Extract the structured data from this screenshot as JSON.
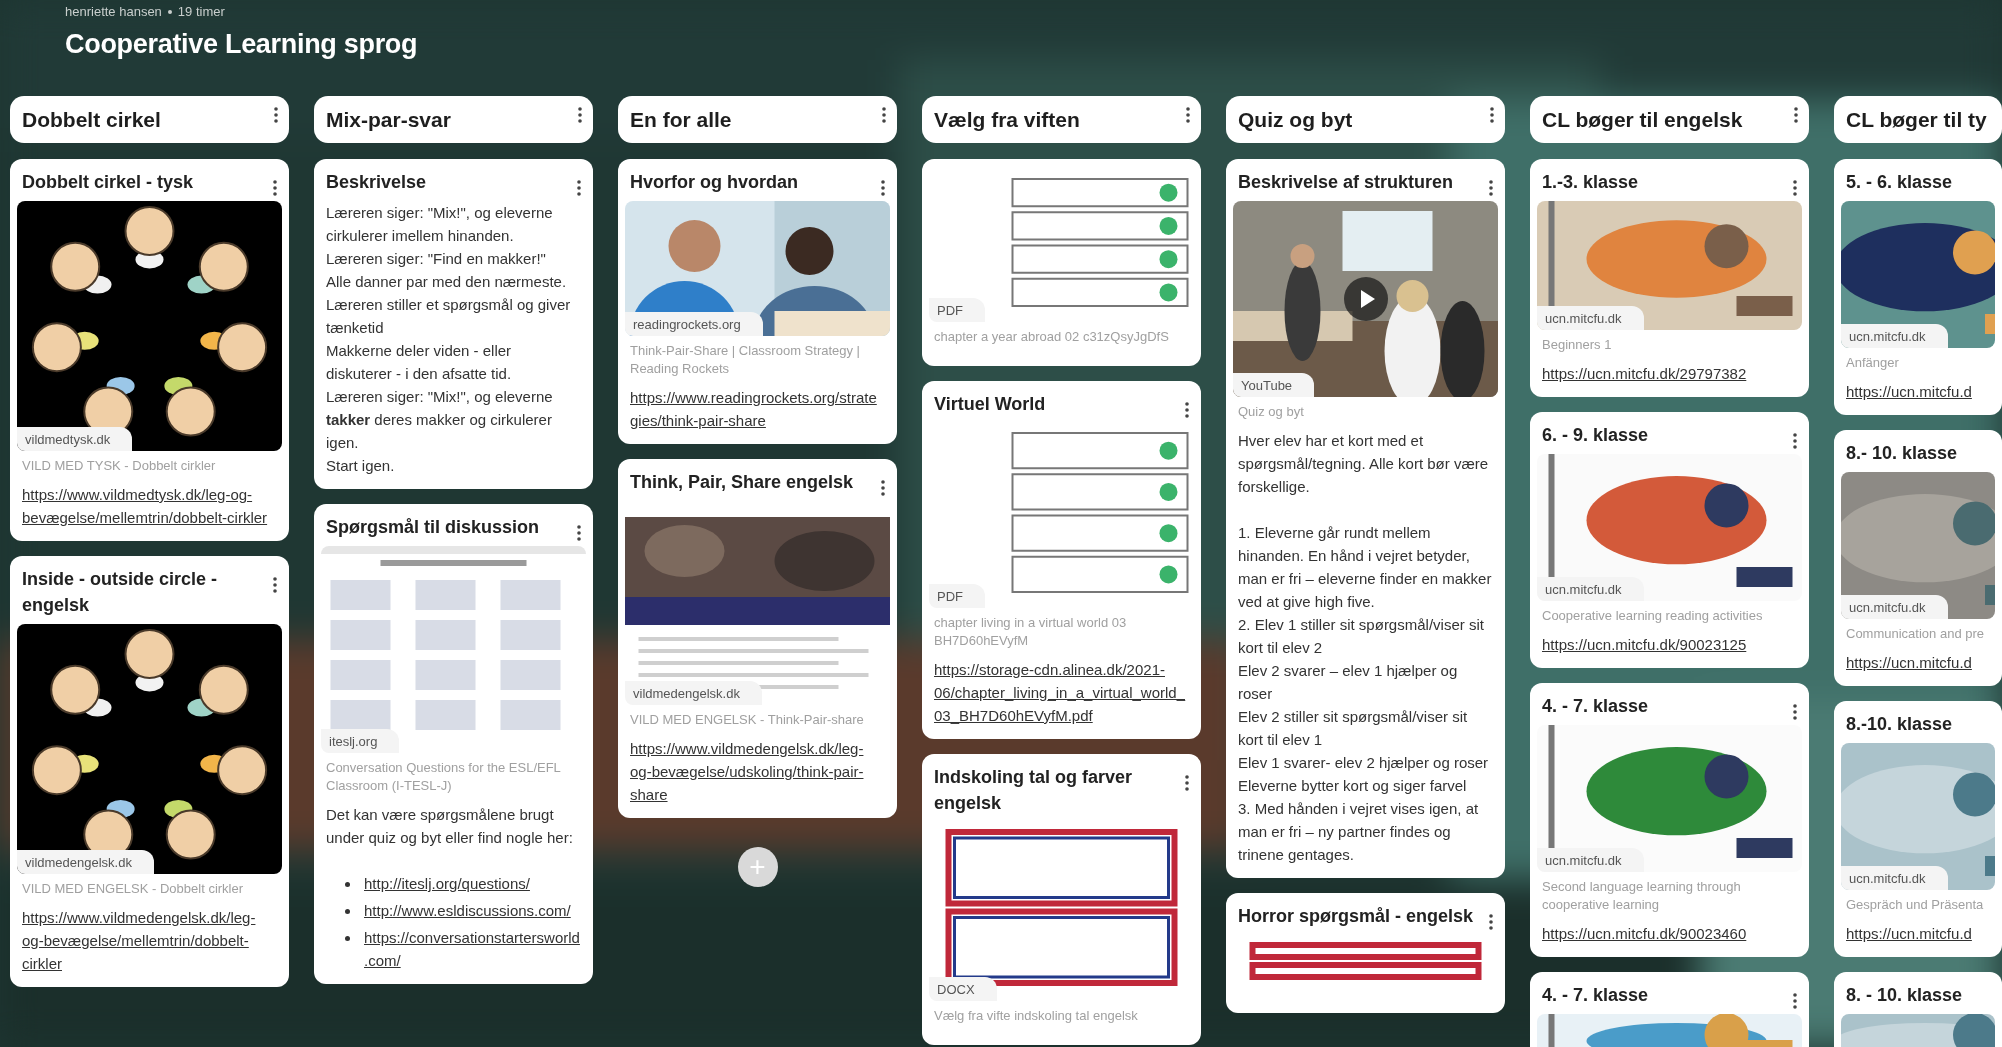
{
  "header": {
    "author": "henriette hansen",
    "time": "19 timer",
    "title": "Cooperative Learning sprog"
  },
  "columns": [
    {
      "title": "Dobbelt cirkel",
      "cut_off": false,
      "posts": [
        {
          "title": "Dobbelt cirkel - tysk",
          "attachment": {
            "kind": "picture",
            "source": "vildmedtysk.dk"
          },
          "caption": "VILD MED TYSK - Dobbelt cirkler",
          "link": "https://www.vildmedtysk.dk/leg-og-bevægelse/mellemtrin/dobbelt-cirkler"
        },
        {
          "title": "Inside - outside circle - engelsk",
          "attachment": {
            "kind": "picture",
            "source": "vildmedengelsk.dk"
          },
          "caption": "VILD MED ENGELSK - Dobbelt cirkler",
          "link": "https://www.vildmedengelsk.dk/leg-og-bevægelse/mellemtrin/dobbelt-cirkler"
        }
      ]
    },
    {
      "title": "Mix-par-svar",
      "cut_off": false,
      "posts": [
        {
          "title": "Beskrivelse",
          "body": [
            [
              "Læreren siger: \"Mix!\", og eleverne cirkulerer imellem hinanden.",
              "Læreren siger: \"Find en makker!\"",
              "Alle danner par med den nærmeste.",
              "Læreren stiller et spørgsmål og giver tænketid",
              "Makkerne deler viden - eller diskuterer - i den afsatte tid.",
              "Læreren siger: \"Mix!\", og eleverne **takker** deres makker og cirkulerer igen.",
              "Start igen."
            ]
          ]
        },
        {
          "title": "Spørgsmål til diskussion",
          "attachment": {
            "kind": "picture",
            "source": "iteslj.org"
          },
          "caption": "Conversation Questions for the ESL/EFL Classroom (I-TESL-J)",
          "body": [
            [
              "Det kan være spørgsmålene brugt under quiz og byt eller find nogle her:"
            ]
          ],
          "links": [
            "http://iteslj.org/questions/",
            "http://www.esldiscussions.com/",
            "https://conversationstartersworld.com/"
          ]
        }
      ]
    },
    {
      "title": "En for alle",
      "cut_off": false,
      "add_button": "+",
      "posts": [
        {
          "title": "Hvorfor og hvordan",
          "attachment": {
            "kind": "picture",
            "source": "readingrockets.org"
          },
          "caption": "Think-Pair-Share | Classroom Strategy | Reading Rockets",
          "link": "https://www.readingrockets.org/strategies/think-pair-share"
        },
        {
          "title": "Think, Pair, Share engelsk",
          "attachment": {
            "kind": "picture",
            "source": "vildmedengelsk.dk"
          },
          "caption": "VILD MED ENGELSK - Think-Pair-share",
          "link": "https://www.vildmedengelsk.dk/leg-og-bevægelse/udskoling/think-pair-share"
        }
      ]
    },
    {
      "title": "Vælg fra viften",
      "cut_off": false,
      "posts": [
        {
          "attachment": {
            "kind": "picture",
            "source": "PDF"
          },
          "caption": "chapter a year abroad 02 c31zQsyJgDfS"
        },
        {
          "title": "Virtuel World",
          "attachment": {
            "kind": "picture",
            "source": "PDF"
          },
          "caption": "chapter living in a virtual world 03 BH7D60hEVyfM",
          "link": "https://storage-cdn.alinea.dk/2021-06/chapter_living_in_a_virtual_world_03_BH7D60hEVyfM.pdf"
        },
        {
          "title": "Indskoling tal og farver engelsk",
          "attachment": {
            "kind": "picture",
            "source": "DOCX"
          },
          "caption": "Vælg fra vifte indskoling tal engelsk"
        }
      ]
    },
    {
      "title": "Quiz og byt",
      "cut_off": false,
      "posts": [
        {
          "title": "Beskrivelse af strukturen",
          "attachment": {
            "kind": "video",
            "source": "YouTube"
          },
          "caption": "Quiz og byt",
          "body": [
            [
              "Hver elev har et kort med et spørgsmål/tegning. Alle kort bør være forskellige."
            ],
            [
              "1. Eleverne går rundt mellem hinanden. En hånd i vejret betyder, man er fri – eleverne finder en makker ved at give high five.",
              "2. Elev 1 stiller sit spørgsmål/viser sit kort til elev 2",
              "Elev 2 svarer – elev 1 hjælper og roser",
              "Elev 2 stiller sit spørgsmål/viser sit kort til elev 1",
              "Elev 1 svarer-  elev 2 hjælper og roser",
              "Eleverne bytter kort og siger farvel",
              "3. Med hånden i vejret vises igen, at man er fri – ny partner findes og trinene gentages."
            ]
          ]
        },
        {
          "title": "Horror spørgsmål - engelsk"
        }
      ]
    },
    {
      "title": "CL bøger til engelsk",
      "cut_off": false,
      "posts": [
        {
          "title": "1.-3. klasse",
          "attachment": {
            "kind": "picture",
            "source": "ucn.mitcfu.dk"
          },
          "caption": "Beginners 1",
          "link": "https://ucn.mitcfu.dk/29797382"
        },
        {
          "title": "6. - 9. klasse",
          "attachment": {
            "kind": "picture",
            "source": "ucn.mitcfu.dk"
          },
          "caption": "Cooperative learning reading activities",
          "link": "https://ucn.mitcfu.dk/90023125"
        },
        {
          "title": "4. - 7. klasse",
          "attachment": {
            "kind": "picture",
            "source": "ucn.mitcfu.dk"
          },
          "caption": "Second language learning through cooperative learning",
          "link": "https://ucn.mitcfu.dk/90023460"
        },
        {
          "title": "4. - 7. klasse"
        }
      ]
    },
    {
      "title": "CL bøger til ty",
      "cut_off": true,
      "posts": [
        {
          "title": "5. - 6. klasse",
          "attachment": {
            "kind": "picture",
            "source": "ucn.mitcfu.dk"
          },
          "caption": "Anfänger",
          "link": "https://ucn.mitcfu.d"
        },
        {
          "title": "8.- 10. klasse",
          "attachment": {
            "kind": "picture",
            "source": "ucn.mitcfu.dk"
          },
          "caption": "Communication and pre",
          "link": "https://ucn.mitcfu.d"
        },
        {
          "title": "8.-10. klasse",
          "attachment": {
            "kind": "picture",
            "source": "ucn.mitcfu.dk"
          },
          "caption": "Gespräch und Präsenta",
          "link": "https://ucn.mitcfu.d"
        },
        {
          "title": "8. - 10. klasse"
        }
      ]
    }
  ]
}
